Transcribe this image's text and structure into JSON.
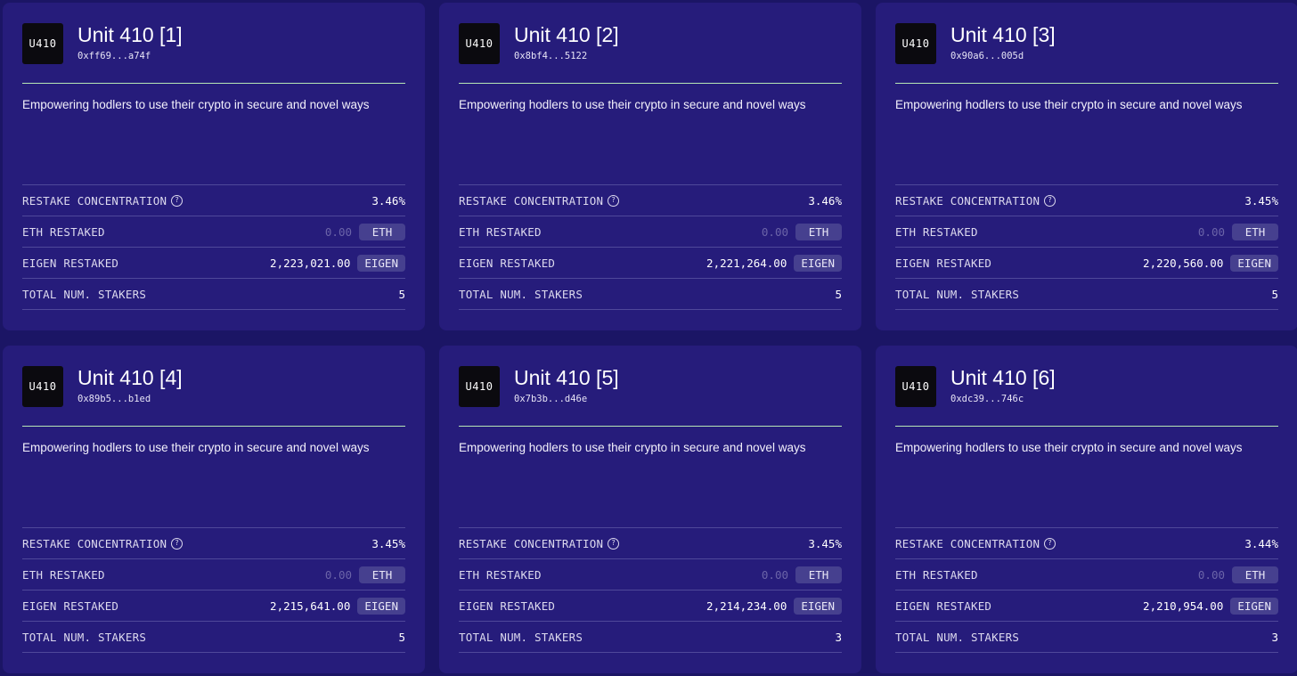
{
  "cards": [
    {
      "logo": "U410",
      "title": "Unit 410 [1]",
      "address": "0xff69...a74f",
      "description": "Empowering hodlers to use their crypto in secure and novel ways",
      "restake_label": "RESTAKE CONCENTRATION",
      "restake_value": "3.46%",
      "eth_label": "ETH RESTAKED",
      "eth_value": "0.00",
      "eth_token": "ETH",
      "eigen_label": "EIGEN RESTAKED",
      "eigen_value": "2,223,021.00",
      "eigen_token": "EIGEN",
      "stakers_label": "TOTAL NUM. STAKERS",
      "stakers_value": "5"
    },
    {
      "logo": "U410",
      "title": "Unit 410 [2]",
      "address": "0x8bf4...5122",
      "description": "Empowering hodlers to use their crypto in secure and novel ways",
      "restake_label": "RESTAKE CONCENTRATION",
      "restake_value": "3.46%",
      "eth_label": "ETH RESTAKED",
      "eth_value": "0.00",
      "eth_token": "ETH",
      "eigen_label": "EIGEN RESTAKED",
      "eigen_value": "2,221,264.00",
      "eigen_token": "EIGEN",
      "stakers_label": "TOTAL NUM. STAKERS",
      "stakers_value": "5"
    },
    {
      "logo": "U410",
      "title": "Unit 410 [3]",
      "address": "0x90a6...005d",
      "description": "Empowering hodlers to use their crypto in secure and novel ways",
      "restake_label": "RESTAKE CONCENTRATION",
      "restake_value": "3.45%",
      "eth_label": "ETH RESTAKED",
      "eth_value": "0.00",
      "eth_token": "ETH",
      "eigen_label": "EIGEN RESTAKED",
      "eigen_value": "2,220,560.00",
      "eigen_token": "EIGEN",
      "stakers_label": "TOTAL NUM. STAKERS",
      "stakers_value": "5"
    },
    {
      "logo": "U410",
      "title": "Unit 410 [4]",
      "address": "0x89b5...b1ed",
      "description": "Empowering hodlers to use their crypto in secure and novel ways",
      "restake_label": "RESTAKE CONCENTRATION",
      "restake_value": "3.45%",
      "eth_label": "ETH RESTAKED",
      "eth_value": "0.00",
      "eth_token": "ETH",
      "eigen_label": "EIGEN RESTAKED",
      "eigen_value": "2,215,641.00",
      "eigen_token": "EIGEN",
      "stakers_label": "TOTAL NUM. STAKERS",
      "stakers_value": "5"
    },
    {
      "logo": "U410",
      "title": "Unit 410 [5]",
      "address": "0x7b3b...d46e",
      "description": "Empowering hodlers to use their crypto in secure and novel ways",
      "restake_label": "RESTAKE CONCENTRATION",
      "restake_value": "3.45%",
      "eth_label": "ETH RESTAKED",
      "eth_value": "0.00",
      "eth_token": "ETH",
      "eigen_label": "EIGEN RESTAKED",
      "eigen_value": "2,214,234.00",
      "eigen_token": "EIGEN",
      "stakers_label": "TOTAL NUM. STAKERS",
      "stakers_value": "3"
    },
    {
      "logo": "U410",
      "title": "Unit 410 [6]",
      "address": "0xdc39...746c",
      "description": "Empowering hodlers to use their crypto in secure and novel ways",
      "restake_label": "RESTAKE CONCENTRATION",
      "restake_value": "3.44%",
      "eth_label": "ETH RESTAKED",
      "eth_value": "0.00",
      "eth_token": "ETH",
      "eigen_label": "EIGEN RESTAKED",
      "eigen_value": "2,210,954.00",
      "eigen_token": "EIGEN",
      "stakers_label": "TOTAL NUM. STAKERS",
      "stakers_value": "3"
    }
  ],
  "colors": {
    "page_background": "#1b1565",
    "card_background": "#261c7b",
    "accent_line": "#b7e6b5",
    "token_badge": "#46408f"
  },
  "icons": {
    "help": "question-circle-icon"
  }
}
